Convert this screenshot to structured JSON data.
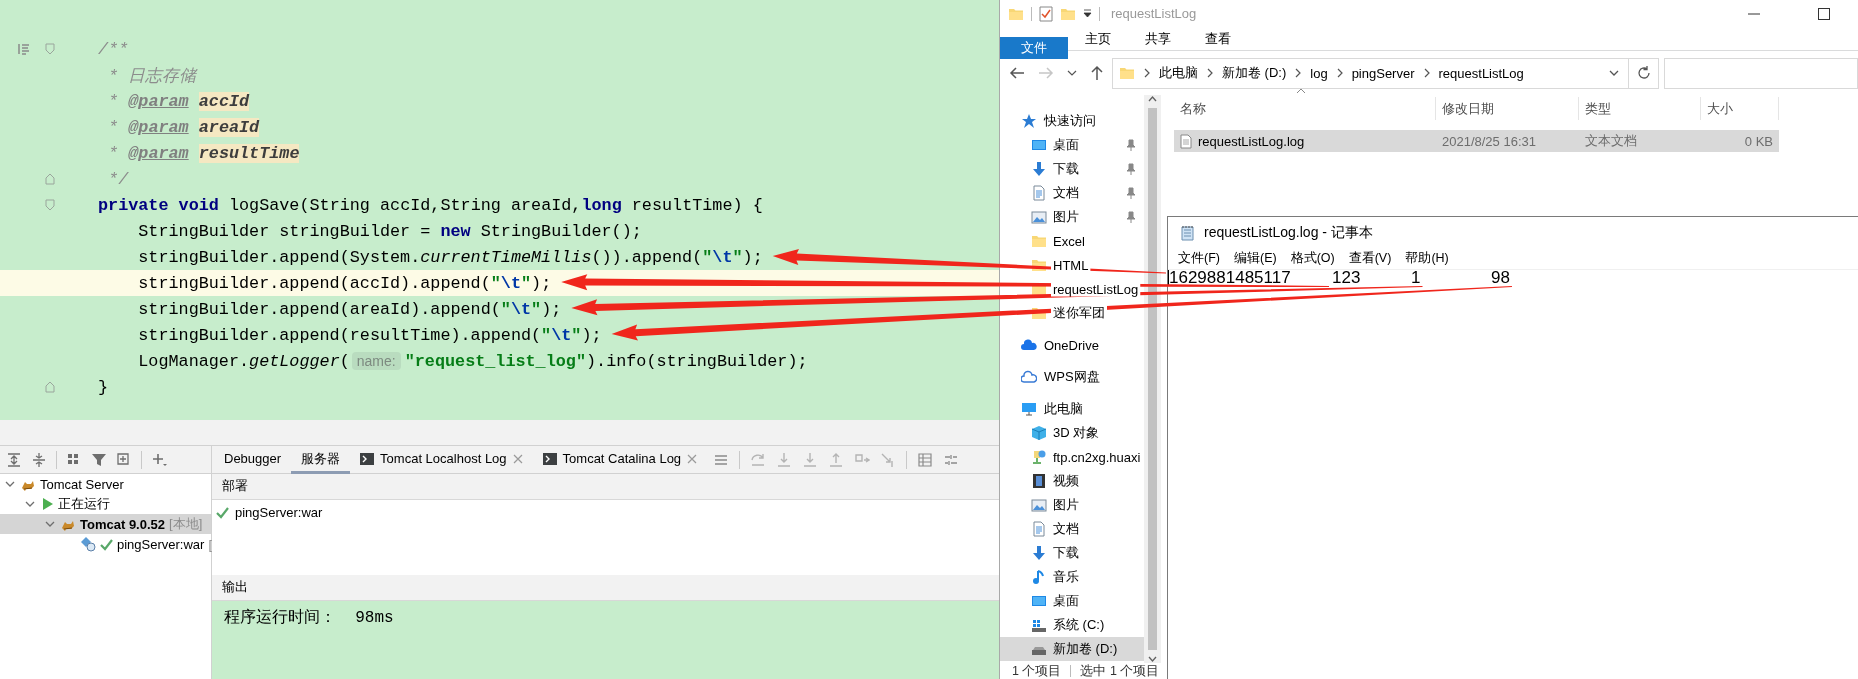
{
  "ide": {
    "editor": {
      "lines": [
        {
          "current": false,
          "pointed": false,
          "kind": "fold_start",
          "doc_toggle": true,
          "tokens": [
            {
              "kind": "comment",
              "text": "/**"
            }
          ]
        },
        {
          "current": false,
          "pointed": false,
          "kind": "plain",
          "tokens": [
            {
              "kind": "comment",
              "text": " * 日志存储"
            }
          ]
        },
        {
          "current": false,
          "pointed": false,
          "kind": "plain",
          "tokens": [
            {
              "kind": "comment",
              "text": " * "
            },
            {
              "kind": "doctag",
              "text": "@param "
            },
            {
              "kind": "docparam",
              "text": "accId"
            }
          ]
        },
        {
          "current": false,
          "pointed": false,
          "kind": "plain",
          "tokens": [
            {
              "kind": "comment",
              "text": " * "
            },
            {
              "kind": "doctag",
              "text": "@param "
            },
            {
              "kind": "docparam",
              "text": "areaId"
            }
          ]
        },
        {
          "current": false,
          "pointed": false,
          "kind": "plain",
          "tokens": [
            {
              "kind": "comment",
              "text": " * "
            },
            {
              "kind": "doctag",
              "text": "@param "
            },
            {
              "kind": "docparam",
              "text": "resultTime"
            }
          ]
        },
        {
          "current": false,
          "pointed": false,
          "kind": "fold_end",
          "tokens": [
            {
              "kind": "comment",
              "text": " */"
            }
          ]
        },
        {
          "current": false,
          "pointed": false,
          "kind": "fold_start",
          "tokens": [
            {
              "kind": "keyword",
              "text": "private "
            },
            {
              "kind": "keyword",
              "text": "void"
            },
            {
              "kind": "plain",
              "text": " logSave(String accId,String areaId,"
            },
            {
              "kind": "keyword",
              "text": "long"
            },
            {
              "kind": "plain",
              "text": " resultTime) {"
            }
          ]
        },
        {
          "current": false,
          "pointed": false,
          "kind": "plain",
          "tokens": [
            {
              "kind": "plain",
              "text": "    StringBuilder stringBuilder = "
            },
            {
              "kind": "keyword",
              "text": "new"
            },
            {
              "kind": "plain",
              "text": " StringBuilder();"
            }
          ]
        },
        {
          "current": false,
          "pointed": true,
          "kind": "plain",
          "tokens": [
            {
              "kind": "plain",
              "text": "    stringBuilder.append(System."
            },
            {
              "kind": "italic",
              "text": "currentTimeMillis"
            },
            {
              "kind": "plain",
              "text": "()).append("
            },
            {
              "kind": "string",
              "text": "\""
            },
            {
              "kind": "escape",
              "text": "\\t"
            },
            {
              "kind": "string",
              "text": "\""
            },
            {
              "kind": "plain",
              "text": ");"
            }
          ]
        },
        {
          "current": true,
          "pointed": true,
          "kind": "plain",
          "tokens": [
            {
              "kind": "plain",
              "text": "    stringBuilder.append(accId).append("
            },
            {
              "kind": "string",
              "text": "\""
            },
            {
              "kind": "escape",
              "text": "\\t"
            },
            {
              "kind": "string",
              "text": "\""
            },
            {
              "kind": "plain",
              "text": ");"
            }
          ]
        },
        {
          "current": false,
          "pointed": true,
          "kind": "plain",
          "tokens": [
            {
              "kind": "plain",
              "text": "    stringBuilder.append(areaId).append("
            },
            {
              "kind": "string",
              "text": "\""
            },
            {
              "kind": "escape",
              "text": "\\t"
            },
            {
              "kind": "string",
              "text": "\""
            },
            {
              "kind": "plain",
              "text": ");"
            }
          ]
        },
        {
          "current": false,
          "pointed": true,
          "kind": "plain",
          "tokens": [
            {
              "kind": "plain",
              "text": "    stringBuilder.append(resultTime).append("
            },
            {
              "kind": "string",
              "text": "\""
            },
            {
              "kind": "escape",
              "text": "\\t"
            },
            {
              "kind": "string",
              "text": "\""
            },
            {
              "kind": "plain",
              "text": ");"
            }
          ]
        },
        {
          "current": false,
          "pointed": false,
          "kind": "plain",
          "tokens": [
            {
              "kind": "plain",
              "text": "    LogManager."
            },
            {
              "kind": "italic",
              "text": "getLogger"
            },
            {
              "kind": "plain",
              "text": "("
            },
            {
              "kind": "hint",
              "text": "name:"
            },
            {
              "kind": "string",
              "text": "\"request_list_log\""
            },
            {
              "kind": "plain",
              "text": ").info(stringBuilder);"
            }
          ]
        },
        {
          "current": false,
          "pointed": false,
          "kind": "fold_end",
          "tokens": [
            {
              "kind": "plain",
              "text": "}"
            }
          ]
        }
      ]
    },
    "tree": [
      {
        "label": "Tomcat Server",
        "kind": "server",
        "expanded": true,
        "selected": false,
        "children": [
          {
            "label": "正在运行",
            "kind": "running",
            "expanded": true,
            "selected": false,
            "children": [
              {
                "label": "Tomcat 9.0.52",
                "note": "[本地]",
                "kind": "tomcat",
                "expanded": true,
                "selected": true,
                "children": [
                  {
                    "label": "pingServer:war",
                    "note": "[",
                    "kind": "artifact",
                    "deployed": true,
                    "selected": false
                  }
                ]
              }
            ]
          }
        ]
      }
    ],
    "tabs": [
      {
        "label": "Debugger",
        "kind": "plain",
        "selected": false
      },
      {
        "label": "服务器",
        "kind": "plain",
        "selected": true
      },
      {
        "label": "Tomcat Localhost Log",
        "kind": "log",
        "selected": false
      },
      {
        "label": "Tomcat Catalina Log",
        "kind": "log",
        "selected": false
      }
    ],
    "deploy": {
      "header": "部署",
      "items": [
        {
          "label": "pingServer:war",
          "deployed": true
        }
      ]
    },
    "output": {
      "header": "输出",
      "text": "程序运行时间：  98ms"
    }
  },
  "explorer": {
    "title": "requestListLog",
    "ribbon": [
      {
        "label": "文件",
        "kind": "file"
      },
      {
        "label": "主页",
        "kind": "tab"
      },
      {
        "label": "共享",
        "kind": "tab"
      },
      {
        "label": "查看",
        "kind": "tab"
      }
    ],
    "path": [
      "此电脑",
      "新加卷 (D:)",
      "log",
      "pingServer",
      "requestListLog"
    ],
    "columns": [
      "名称",
      "修改日期",
      "类型",
      "大小"
    ],
    "files": [
      {
        "name": "requestListLog.log",
        "date": "2021/8/25 16:31",
        "type": "文本文档",
        "size": "0 KB",
        "selected": true
      }
    ],
    "nav": [
      {
        "label": "快速访问",
        "kind": "star",
        "selected": false,
        "children": [
          {
            "label": "桌面",
            "kind": "desktop",
            "pinned": true,
            "selected": false
          },
          {
            "label": "下载",
            "kind": "download",
            "pinned": true,
            "selected": false
          },
          {
            "label": "文档",
            "kind": "docs",
            "pinned": true,
            "selected": false
          },
          {
            "label": "图片",
            "kind": "pictures",
            "pinned": true,
            "selected": false
          },
          {
            "label": "Excel",
            "kind": "folder",
            "pinned": false,
            "selected": false
          },
          {
            "label": "HTML",
            "kind": "folder",
            "pinned": false,
            "selected": false
          },
          {
            "label": "requestListLog",
            "kind": "folder",
            "pinned": false,
            "selected": false
          },
          {
            "label": "迷你军团",
            "kind": "folder",
            "pinned": false,
            "selected": false
          }
        ]
      },
      {
        "label": "OneDrive",
        "kind": "cloud",
        "selected": false
      },
      {
        "label": "WPS网盘",
        "kind": "wps",
        "selected": false
      },
      {
        "label": "此电脑",
        "kind": "pc",
        "selected": false,
        "children": [
          {
            "label": "3D 对象",
            "kind": "cube",
            "selected": false
          },
          {
            "label": "ftp.cn2xg.huaxi",
            "kind": "ftp",
            "selected": false
          },
          {
            "label": "视频",
            "kind": "video",
            "selected": false
          },
          {
            "label": "图片",
            "kind": "pictures",
            "selected": false
          },
          {
            "label": "文档",
            "kind": "docs",
            "selected": false
          },
          {
            "label": "下载",
            "kind": "download",
            "selected": false
          },
          {
            "label": "音乐",
            "kind": "music",
            "selected": false
          },
          {
            "label": "桌面",
            "kind": "desktop",
            "selected": false
          },
          {
            "label": "系统 (C:)",
            "kind": "system",
            "selected": false
          },
          {
            "label": "新加卷 (D:)",
            "kind": "drive",
            "selected": true
          }
        ]
      }
    ],
    "status": [
      "1 个项目",
      "选中 1 个项目"
    ]
  },
  "notepad": {
    "title": "requestListLog.log - 记事本",
    "menu": [
      "文件(F)",
      "编辑(E)",
      "格式(O)",
      "查看(V)",
      "帮助(H)"
    ],
    "fields": [
      "1629881485117",
      "123",
      "1",
      "98"
    ]
  }
}
